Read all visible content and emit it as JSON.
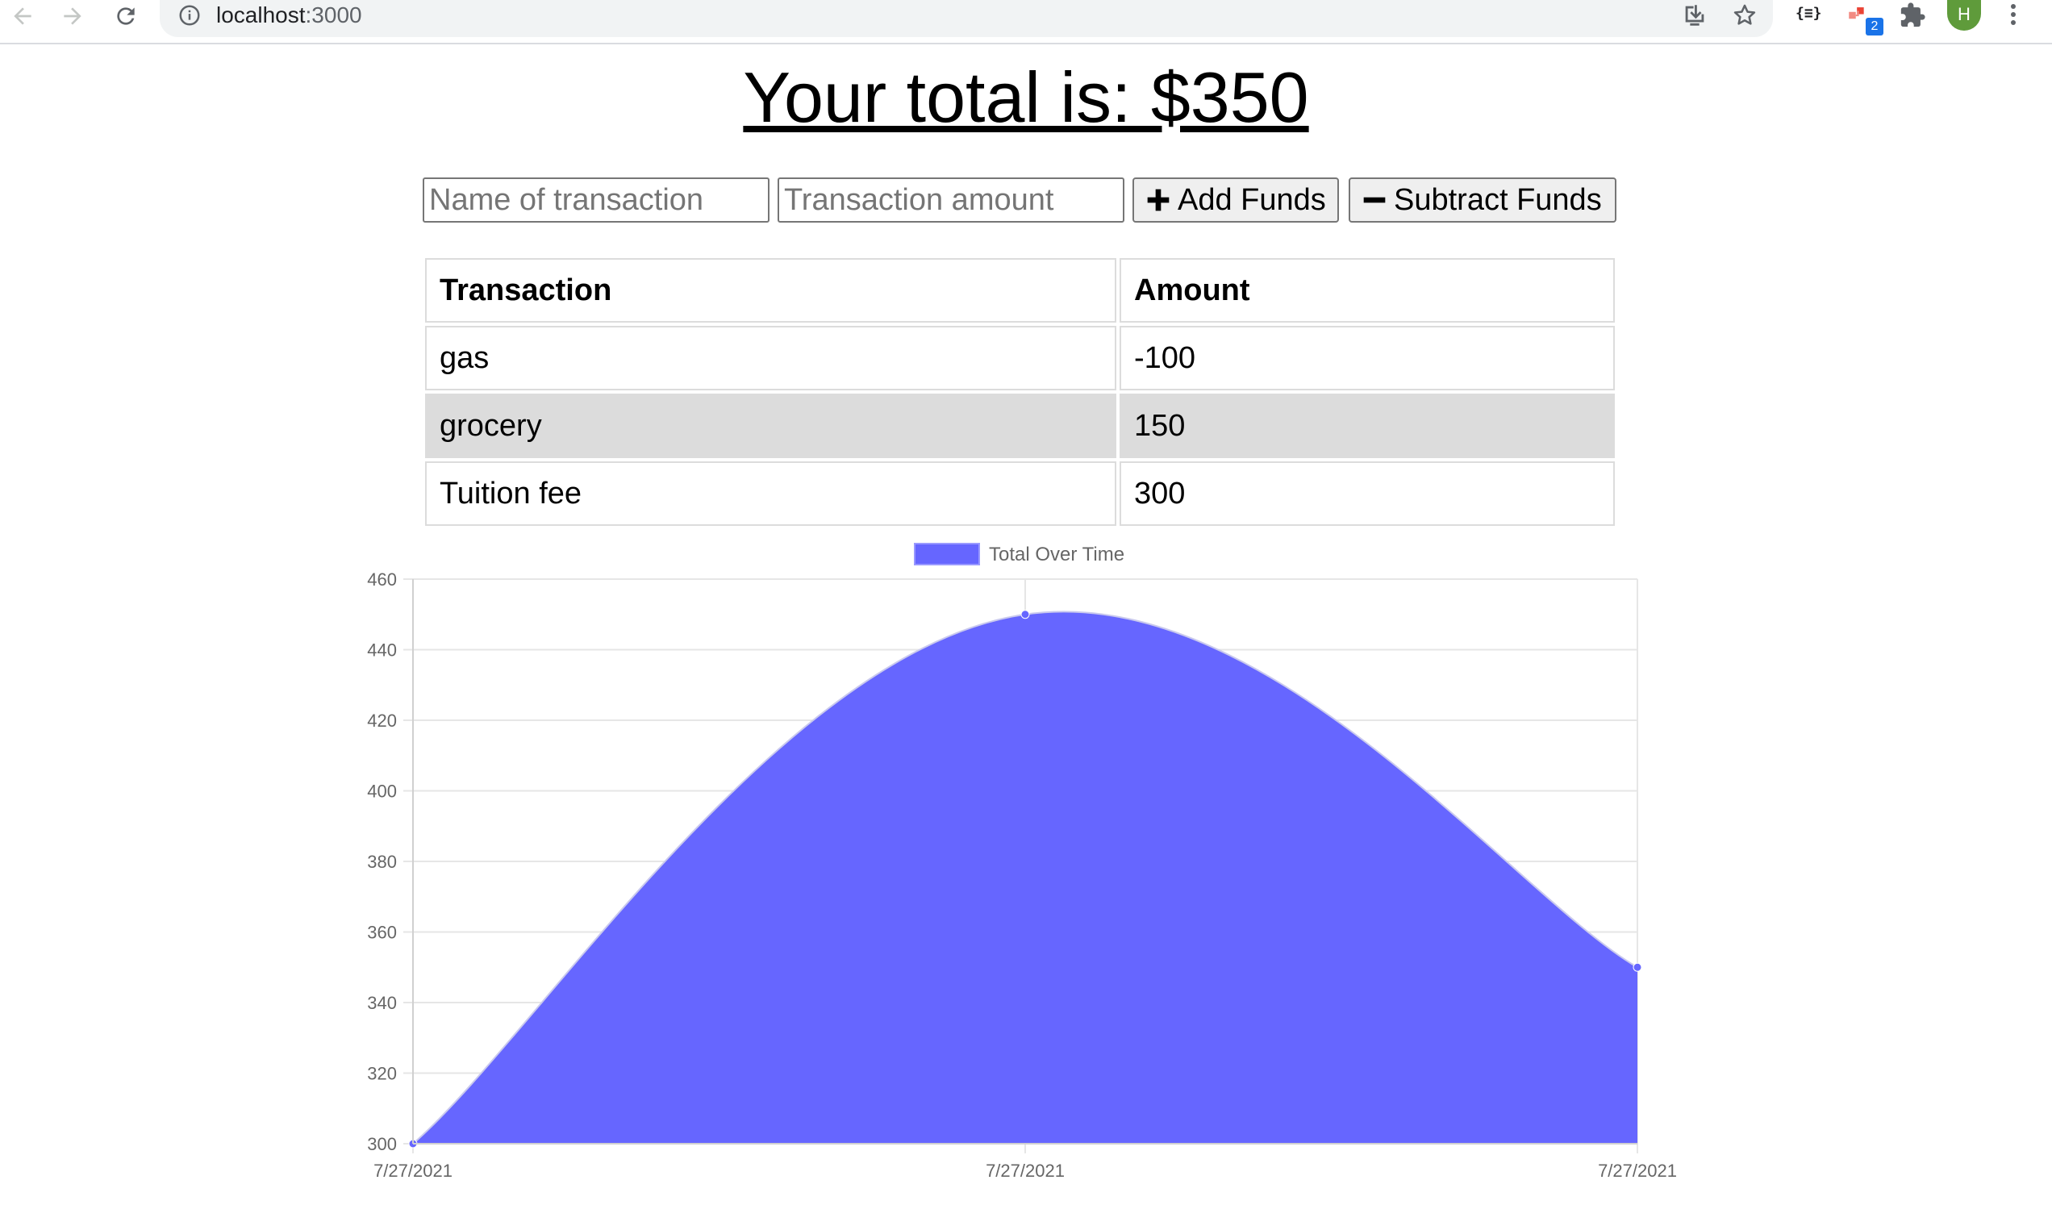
{
  "browser": {
    "url_host": "localhost",
    "url_port": ":3000",
    "avatar_letter": "H",
    "extension_badge": "2"
  },
  "page": {
    "title": "Your total is: $350"
  },
  "form": {
    "name_placeholder": "Name of transaction",
    "amount_placeholder": "Transaction amount",
    "add_label": "Add Funds",
    "subtract_label": "Subtract Funds"
  },
  "table": {
    "headers": [
      "Transaction",
      "Amount"
    ],
    "rows": [
      {
        "name": "gas",
        "amount": "-100"
      },
      {
        "name": "grocery",
        "amount": "150"
      },
      {
        "name": "Tuition fee",
        "amount": "300"
      }
    ]
  },
  "chart_data": {
    "type": "area",
    "title": "",
    "xlabel": "",
    "ylabel": "",
    "legend_position": "top",
    "grid": true,
    "x": [
      "7/27/2021",
      "7/27/2021",
      "7/27/2021"
    ],
    "series": [
      {
        "name": "Total Over Time",
        "values": [
          300,
          450,
          350
        ],
        "color": "#6666ff"
      }
    ],
    "ylim": [
      300,
      460
    ],
    "yticks": [
      300,
      320,
      340,
      360,
      380,
      400,
      420,
      440,
      460
    ]
  }
}
